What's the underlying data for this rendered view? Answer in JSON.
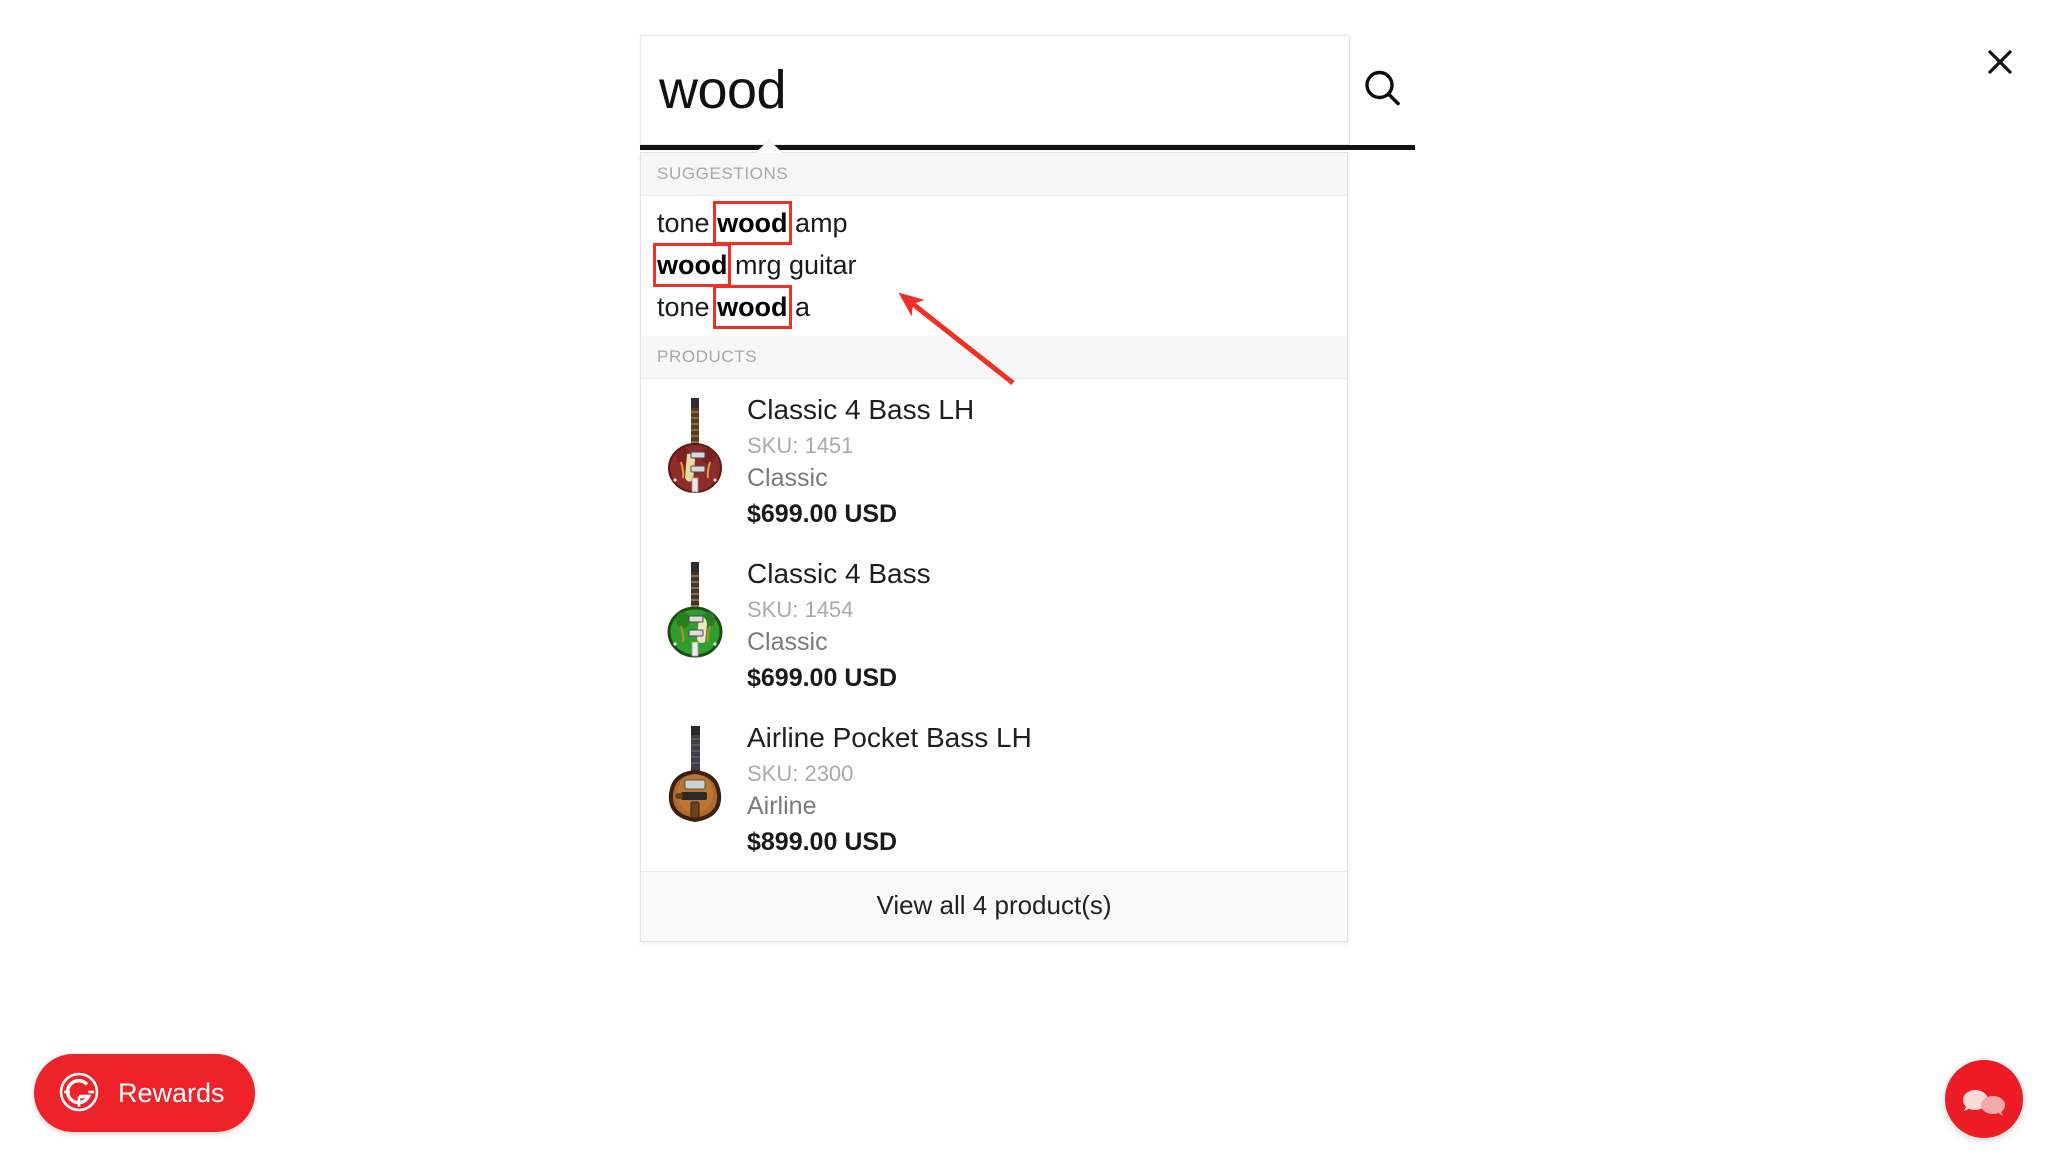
{
  "window": {
    "background_color": "#ffffff"
  },
  "close": {
    "label": "×",
    "icon": "close-icon"
  },
  "search": {
    "value": "wood",
    "placeholder": "Search",
    "submit_icon": "search-icon"
  },
  "dropdown": {
    "suggestions_header": "SUGGESTIONS",
    "products_header": "PRODUCTS",
    "suggestions": [
      {
        "prefix": "tone ",
        "match": "wood",
        "suffix": " amp"
      },
      {
        "prefix": "",
        "match": "wood",
        "suffix": " mrg guitar"
      },
      {
        "prefix": "tone ",
        "match": "wood",
        "suffix": " a"
      }
    ],
    "products": [
      {
        "title": "Classic 4 Bass LH",
        "sku": "SKU: 1451",
        "brand": "Classic",
        "price": "$699.00 USD",
        "thumb": "guitar-thumb-maroon",
        "body_color": "#8e2b2b",
        "body_edge": "#5c1a1a",
        "pickguard_color": "#e8dca0"
      },
      {
        "title": "Classic 4 Bass",
        "sku": "SKU: 1454",
        "brand": "Classic",
        "price": "$699.00 USD",
        "thumb": "guitar-thumb-green",
        "body_color": "#2f9e2f",
        "body_edge": "#1d4d15",
        "pickguard_color": "#f1e8c2"
      },
      {
        "title": "Airline Pocket Bass LH",
        "sku": "SKU: 2300",
        "brand": "Airline",
        "price": "$899.00 USD",
        "thumb": "guitar-thumb-sunburst",
        "body_color": "#b0682c",
        "body_edge": "#3a2110",
        "pickguard_color": "#d8d8d8"
      }
    ],
    "view_all_label": "View all 4 product(s)"
  },
  "annotation": {
    "color": "#ee3124",
    "arrow_name": "red-arrow-annotation",
    "highlight_boxes": 3
  },
  "rewards": {
    "label": "Rewards",
    "icon": "rewards-g-logo-icon",
    "color": "#ee2229"
  },
  "chat": {
    "icon": "chat-bubbles-icon",
    "color": "#ed1c24"
  }
}
